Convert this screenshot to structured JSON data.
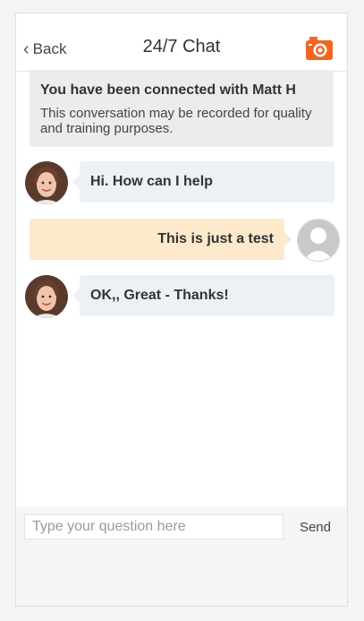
{
  "header": {
    "back_label": "Back",
    "title": "24/7 Chat",
    "camera_icon": "camera-icon",
    "accent_color": "#f26522"
  },
  "notice": {
    "title": "You have been connected with Matt H",
    "body": "This conversation may be recorded for quality and training purposes."
  },
  "messages": [
    {
      "sender": "agent",
      "text": "Hi. How can I help"
    },
    {
      "sender": "user",
      "text": "This is just a test"
    },
    {
      "sender": "agent",
      "text": "OK,, Great - Thanks!"
    }
  ],
  "composer": {
    "placeholder": "Type your question here",
    "value": "",
    "send_label": "Send"
  }
}
